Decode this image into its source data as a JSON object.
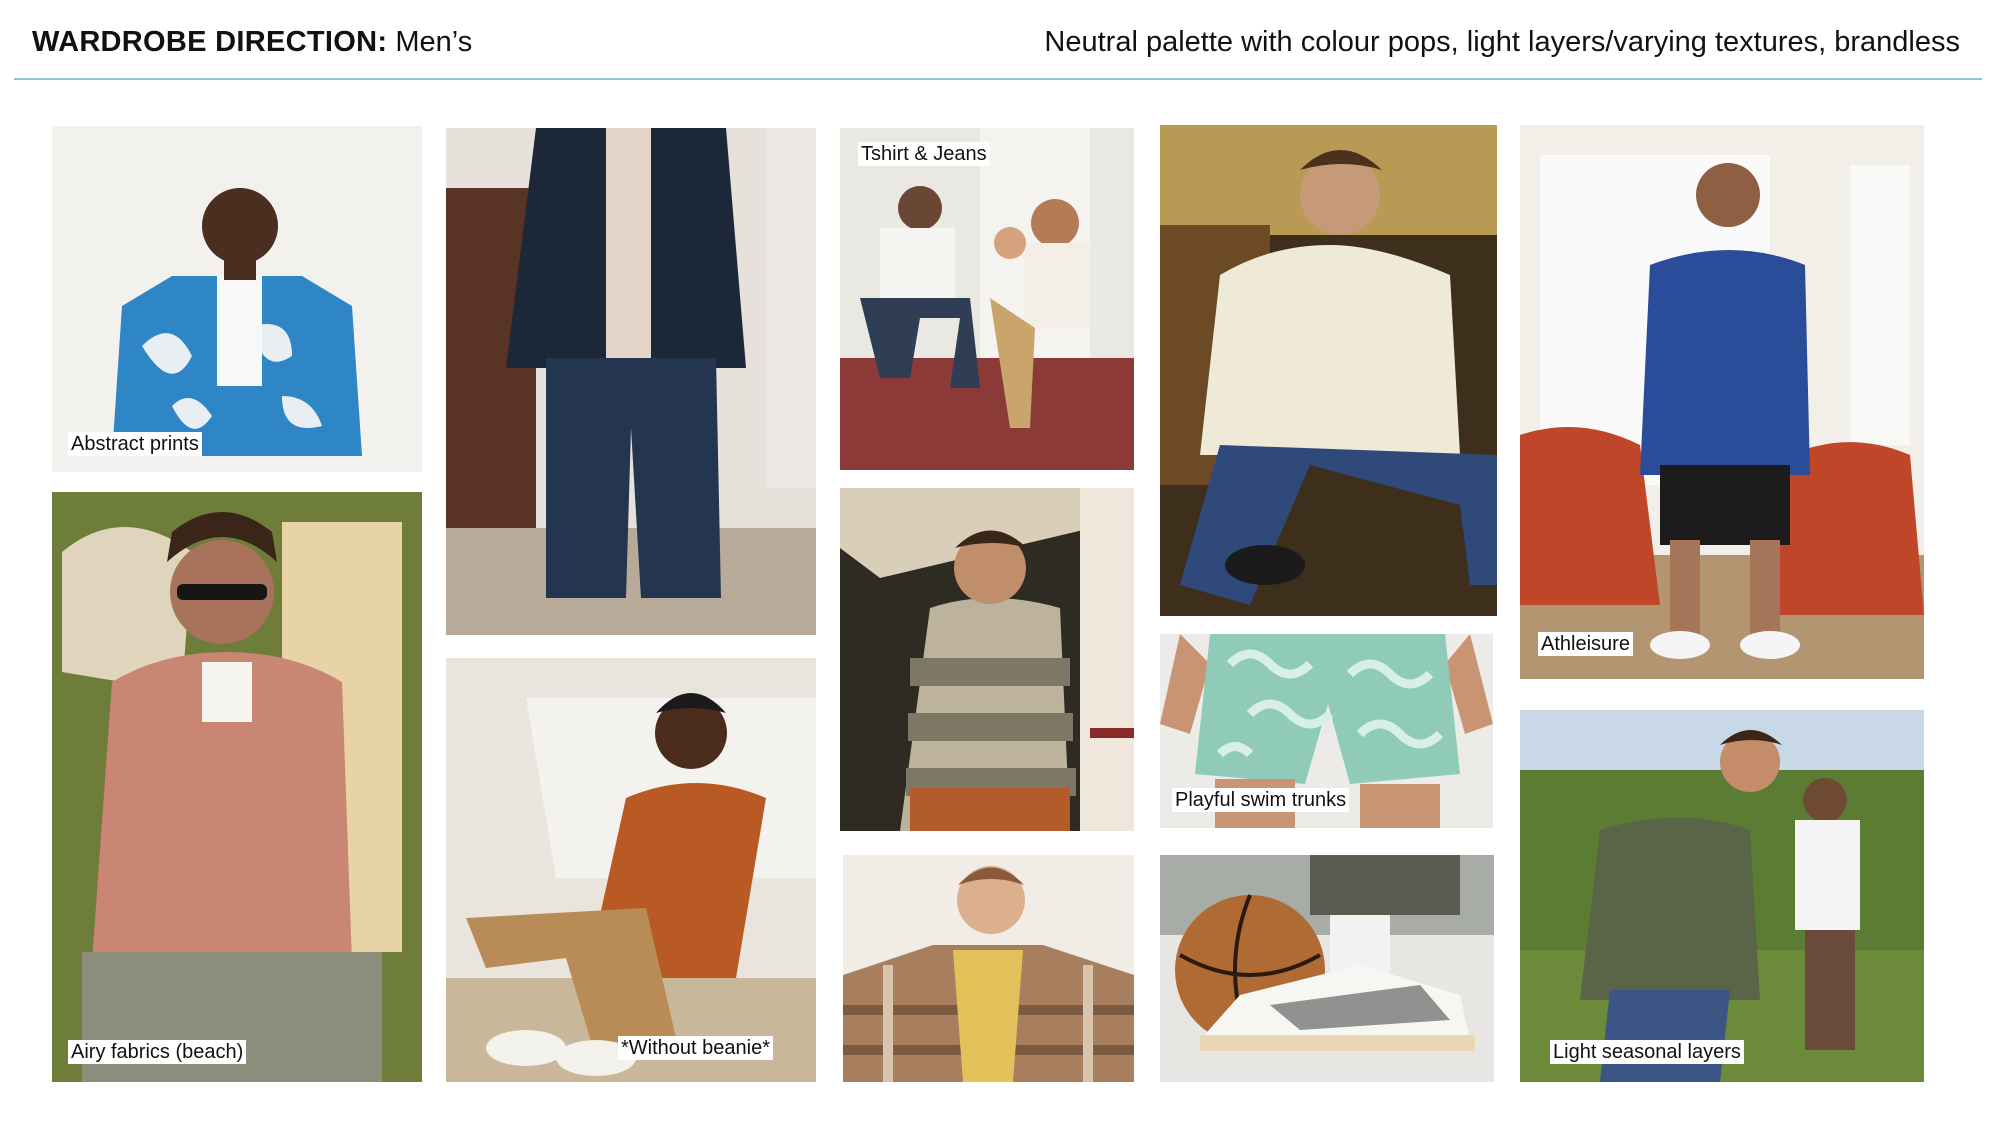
{
  "header": {
    "title_bold": "WARDROBE DIRECTION:",
    "title_light": "Men’s",
    "tagline": "Neutral palette with colour pops, light layers/varying textures, brandless"
  },
  "tiles": {
    "abstract_prints": {
      "caption": "Abstract prints"
    },
    "denim_jacket": {
      "caption": ""
    },
    "tshirt_jeans": {
      "caption": "Tshirt & Jeans"
    },
    "cream_sweater": {
      "caption": ""
    },
    "athleisure": {
      "caption": "Athleisure"
    },
    "airy_fabrics": {
      "caption": "Airy fabrics (beach)"
    },
    "beanie": {
      "caption": "*Without beanie*"
    },
    "striped_vest": {
      "caption": ""
    },
    "swim_trunks": {
      "caption": "Playful swim trunks"
    },
    "seasonal_layers": {
      "caption": "Light seasonal layers"
    },
    "flannel_shirt": {
      "caption": ""
    },
    "sneakers": {
      "caption": ""
    }
  }
}
